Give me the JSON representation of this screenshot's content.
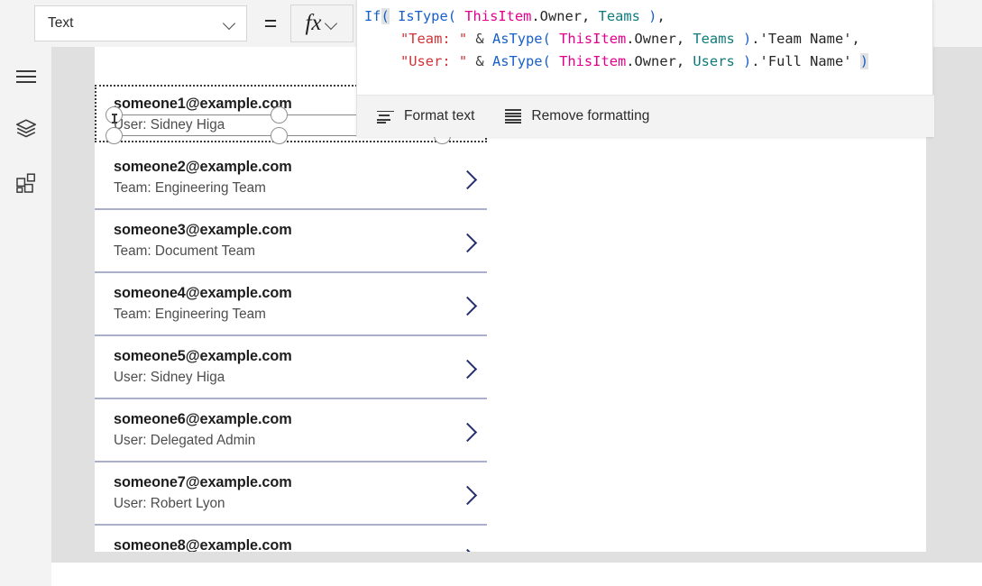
{
  "topbar": {
    "property_selector": {
      "value": "Text",
      "icon": "chevron-down-icon"
    },
    "equals": "=",
    "fx_button": {
      "glyph": "fx",
      "icon": "chevron-down-icon"
    }
  },
  "formula_bar": {
    "lines": [
      {
        "indent": false,
        "tokens": [
          {
            "text": "If",
            "kind": "fn"
          },
          {
            "text": "(",
            "kind": "par-hl"
          },
          {
            "text": " ",
            "kind": "plain"
          },
          {
            "text": "IsType",
            "kind": "fn"
          },
          {
            "text": "( ",
            "kind": "par"
          },
          {
            "text": "ThisItem",
            "kind": "self"
          },
          {
            "text": ".Owner, ",
            "kind": "plain"
          },
          {
            "text": "Teams",
            "kind": "type"
          },
          {
            "text": " )",
            "kind": "par"
          },
          {
            "text": ",",
            "kind": "plain"
          }
        ]
      },
      {
        "indent": true,
        "tokens": [
          {
            "text": "\"Team: \"",
            "kind": "str"
          },
          {
            "text": " & ",
            "kind": "amp"
          },
          {
            "text": "AsType",
            "kind": "fn"
          },
          {
            "text": "( ",
            "kind": "par"
          },
          {
            "text": "ThisItem",
            "kind": "self"
          },
          {
            "text": ".Owner, ",
            "kind": "plain"
          },
          {
            "text": "Teams",
            "kind": "type"
          },
          {
            "text": " )",
            "kind": "par"
          },
          {
            "text": ".'Team Name',",
            "kind": "plain"
          }
        ]
      },
      {
        "indent": true,
        "tokens": [
          {
            "text": "\"User: \"",
            "kind": "str"
          },
          {
            "text": " & ",
            "kind": "amp"
          },
          {
            "text": "AsType",
            "kind": "fn"
          },
          {
            "text": "( ",
            "kind": "par"
          },
          {
            "text": "ThisItem",
            "kind": "self"
          },
          {
            "text": ".Owner, ",
            "kind": "plain"
          },
          {
            "text": "Users",
            "kind": "type"
          },
          {
            "text": " )",
            "kind": "par"
          },
          {
            "text": ".'Full Name' ",
            "kind": "plain"
          },
          {
            "text": ")",
            "kind": "par-hl"
          }
        ]
      }
    ],
    "raw_text": "If( IsType( ThisItem.Owner, Teams ),\n    \"Team: \" & AsType( ThisItem.Owner, Teams ).'Team Name',\n    \"User: \" & AsType( ThisItem.Owner, Users ).'Full Name' )",
    "toolbar": {
      "format_text": {
        "label": "Format text",
        "icon": "format-text-icon"
      },
      "remove_formatting": {
        "label": "Remove formatting",
        "icon": "remove-formatting-icon"
      }
    }
  },
  "rail": {
    "items": [
      {
        "name": "menu",
        "icon": "hamburger-menu-icon"
      },
      {
        "name": "tree-view",
        "icon": "layers-icon"
      },
      {
        "name": "insert",
        "icon": "grid-components-icon"
      }
    ]
  },
  "gallery": {
    "items": [
      {
        "title": "someone1@example.com",
        "subtitle": "User: Sidney Higa",
        "selected": true,
        "chevron": false
      },
      {
        "title": "someone2@example.com",
        "subtitle": "Team: Engineering Team",
        "selected": false,
        "chevron": true
      },
      {
        "title": "someone3@example.com",
        "subtitle": "Team: Document Team",
        "selected": false,
        "chevron": true
      },
      {
        "title": "someone4@example.com",
        "subtitle": "Team: Engineering Team",
        "selected": false,
        "chevron": true
      },
      {
        "title": "someone5@example.com",
        "subtitle": "User: Sidney Higa",
        "selected": false,
        "chevron": true
      },
      {
        "title": "someone6@example.com",
        "subtitle": "User: Delegated Admin",
        "selected": false,
        "chevron": true
      },
      {
        "title": "someone7@example.com",
        "subtitle": "User: Robert Lyon",
        "selected": false,
        "chevron": true
      },
      {
        "title": "someone8@example.com",
        "subtitle": "",
        "selected": false,
        "chevron": true
      }
    ]
  },
  "colors": {
    "chrome_bg": "#f3f3f3",
    "canvas_bg": "#e0e0e0",
    "app_bg": "#ffffff",
    "separator": "#aab0cc",
    "chevron": "#24306e",
    "token_function": "#1860c8",
    "token_thisitem": "#e3008c",
    "token_type": "#0f7a7a",
    "token_string": "#d03438",
    "selection_outline": "#3a3a3a"
  }
}
